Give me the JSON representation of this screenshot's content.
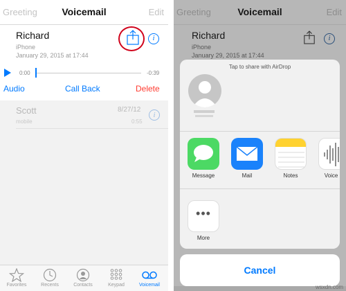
{
  "left_screen": {
    "nav": {
      "left_label": "Greeting",
      "title": "Voicemail",
      "right_label": "Edit"
    },
    "expanded_voicemail": {
      "name": "Richard",
      "label": "iPhone",
      "date": "January 29, 2015 at 17:44",
      "time_elapsed": "0:00",
      "time_remaining": "-0:39",
      "playback_progress": 0,
      "actions": {
        "audio": "Audio",
        "call_back": "Call Back",
        "delete": "Delete"
      }
    },
    "voicemails": [
      {
        "name": "Scott",
        "label": "mobile",
        "date": "8/27/12",
        "duration": "0:55"
      }
    ],
    "tabs": [
      {
        "label": "Favorites",
        "icon": "star-icon"
      },
      {
        "label": "Recents",
        "icon": "clock-icon"
      },
      {
        "label": "Contacts",
        "icon": "contacts-icon"
      },
      {
        "label": "Keypad",
        "icon": "keypad-icon"
      },
      {
        "label": "Voicemail",
        "icon": "voicemail-icon",
        "active": true
      }
    ]
  },
  "right_screen": {
    "nav": {
      "left_label": "Greeting",
      "title": "Voicemail",
      "right_label": "Edit"
    },
    "background_voicemail": {
      "name": "Richard",
      "label": "iPhone",
      "date": "January 29, 2015 at 17:44"
    },
    "share_sheet": {
      "airdrop_title": "Tap to share with AirDrop",
      "apps": [
        {
          "label": "Message",
          "icon": "message-icon"
        },
        {
          "label": "Mail",
          "icon": "mail-icon"
        },
        {
          "label": "Notes",
          "icon": "notes-icon"
        },
        {
          "label": "Voice M",
          "icon": "voice-memo-icon"
        }
      ],
      "more_label": "More",
      "cancel_label": "Cancel"
    }
  },
  "watermark": "wsxdn.com",
  "colors": {
    "accent": "#007aff",
    "destructive": "#ff3b30",
    "highlight_circle": "#d0021b"
  }
}
